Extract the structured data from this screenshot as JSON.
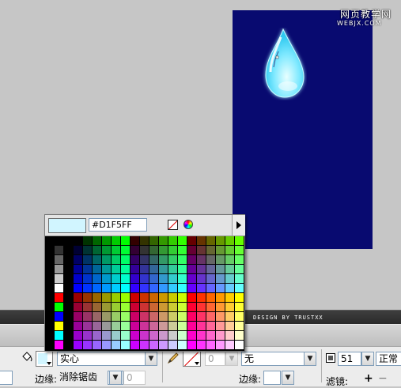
{
  "watermark": {
    "cn": "网页教学网",
    "url": "WEBJX.COM"
  },
  "credit": "DESIGN BY TRUSTXX",
  "swatch_popup": {
    "hex": "#D1F5FF",
    "preview_color": "#D1F5FF",
    "no_color_icon": "no-color-icon",
    "wheel_icon": "color-wheel-icon",
    "menu_icon": "panel-menu-arrow-icon"
  },
  "properties": {
    "fill_style": "实心",
    "stroke_width": "0",
    "stroke_style": "无",
    "edge_label_left": "边缘:",
    "edge_value_left": "消除锯齿",
    "edge_num_left": "0",
    "edge_label_right": "边缘:",
    "alpha": "51",
    "blend": "正常",
    "filters_label": "滤镜:",
    "add_icon": "+",
    "remove_icon": "−",
    "fill_color": "#D1F5FF",
    "stroke_color": "#FFFFFF"
  },
  "stage": {
    "background": "#080A70"
  }
}
